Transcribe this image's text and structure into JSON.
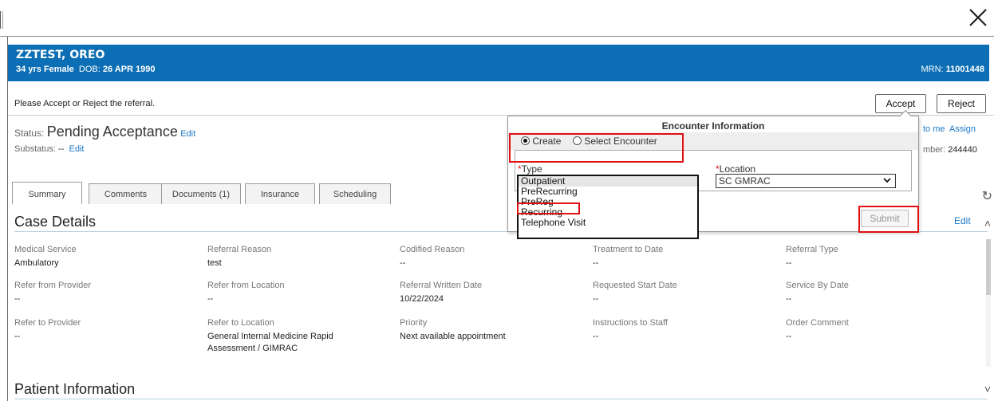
{
  "window": {
    "close_icon": "close-icon"
  },
  "patient": {
    "name": "ZZTEST, OREO",
    "age_sex": "34 yrs  Female",
    "dob_label": "DOB:",
    "dob": "26 APR 1990",
    "mrn_label": "MRN:",
    "mrn": "11001448"
  },
  "prompt": {
    "text": "Please Accept or Reject the referral.",
    "accept_label": "Accept",
    "reject_label": "Reject"
  },
  "status": {
    "label": "Status:",
    "value": "Pending Acceptance",
    "edit_label": "Edit",
    "substatus_label": "Substatus:",
    "substatus_value": "--",
    "substatus_edit": "Edit",
    "assign_to_me": "to me",
    "assign": "Assign",
    "number_label": "mber:",
    "number_value": "244440"
  },
  "tabs": [
    {
      "label": "Summary"
    },
    {
      "label": "Comments"
    },
    {
      "label": "Documents (1)"
    },
    {
      "label": "Insurance"
    },
    {
      "label": "Scheduling"
    }
  ],
  "case_details": {
    "title": "Case Details",
    "edit_label": "Edit",
    "fields": [
      {
        "label": "Medical Service",
        "value": "Ambulatory"
      },
      {
        "label": "Referral Reason",
        "value": "test"
      },
      {
        "label": "Codified Reason",
        "value": "--"
      },
      {
        "label": "Treatment to Date",
        "value": "--"
      },
      {
        "label": "Referral Type",
        "value": "--"
      },
      {
        "label": "Refer from Provider",
        "value": "--"
      },
      {
        "label": "Refer from Location",
        "value": "--"
      },
      {
        "label": "Referral Written Date",
        "value": "10/22/2024"
      },
      {
        "label": "Requested Start Date",
        "value": "--"
      },
      {
        "label": "Service By Date",
        "value": "--"
      },
      {
        "label": "Refer to Provider",
        "value": "--"
      },
      {
        "label": "Refer to Location",
        "value": "General Internal Medicine Rapid Assessment / GIMRAC"
      },
      {
        "label": "Priority",
        "value": "Next available appointment"
      },
      {
        "label": "Instructions to Staff",
        "value": "--"
      },
      {
        "label": "Order Comment",
        "value": "--"
      }
    ]
  },
  "patient_info": {
    "title": "Patient Information"
  },
  "encounter_popup": {
    "title": "Encounter Information",
    "create_label": "Create",
    "select_label": "Select Encounter",
    "type_required": "*",
    "type_label": "Type",
    "type_options": [
      "Outpatient",
      "PreRecurring",
      "PreReg",
      "Recurring",
      "Telephone Visit"
    ],
    "type_selected": "Outpatient",
    "location_required": "*",
    "location_label": "Location",
    "location_value": "SC GMRAC",
    "submit_label": "Submit"
  },
  "colors": {
    "banner": "#0c6eb4",
    "annotation_red": "#e01010",
    "link": "#1f78c8"
  }
}
